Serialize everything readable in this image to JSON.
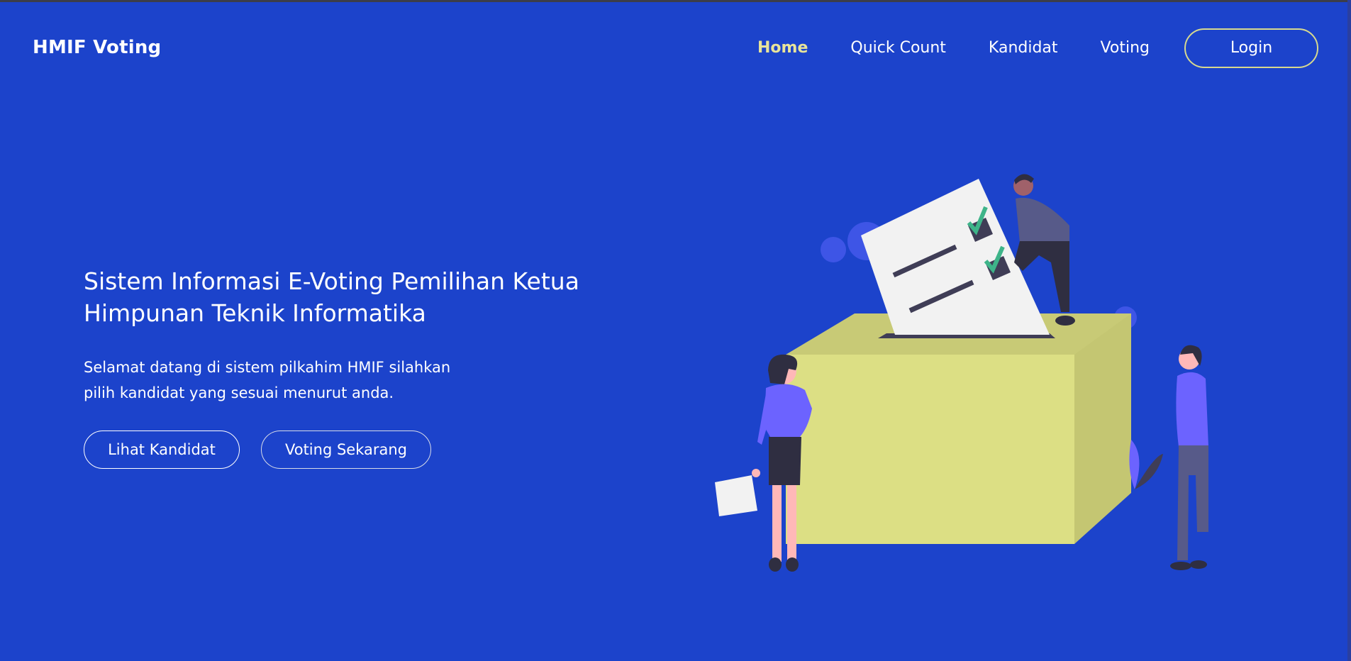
{
  "app": {
    "brand": "HMIF Voting"
  },
  "nav": {
    "items": [
      {
        "label": "Home",
        "active": true
      },
      {
        "label": "Quick Count",
        "active": false
      },
      {
        "label": "Kandidat",
        "active": false
      },
      {
        "label": "Voting",
        "active": false
      }
    ],
    "login_label": "Login"
  },
  "hero": {
    "title": "Sistem Informasi E-Voting Pemilihan Ketua Himpunan Teknik Informatika",
    "subtitle": "Selamat datang di sistem pilkahim HMIF silahkan pilih kandidat yang sesuai menurut anda.",
    "buttons": {
      "lihat_label": "Lihat Kandidat",
      "voting_label": "Voting Sekarang"
    }
  },
  "colors": {
    "background": "#1c43cb",
    "active_nav": "#e8e49a",
    "login_border": "#d7d98f",
    "ballot_box": "#dcdf84",
    "person_shirt": "#6c63ff"
  },
  "icons": {
    "illustration": "ballot-box-voting-illustration"
  }
}
